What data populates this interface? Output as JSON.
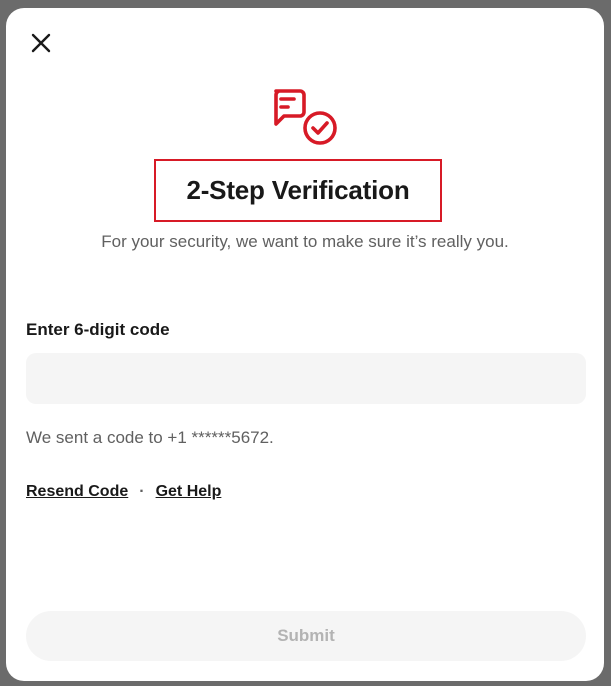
{
  "dialog": {
    "close_icon": "close-icon",
    "header_icon": "chat-check-icon",
    "title": "2-Step Verification",
    "subtitle": "For your security, we want to make sure it’s really you.",
    "code_field": {
      "label": "Enter 6-digit code",
      "value": "",
      "placeholder": ""
    },
    "sent_message": "We sent a code to +1 ******5672.",
    "links": {
      "resend": "Resend Code",
      "separator": "·",
      "help": "Get Help"
    },
    "submit_label": "Submit"
  },
  "colors": {
    "accent": "#d71a26",
    "text_primary": "#191919",
    "text_secondary": "#606060",
    "input_bg": "#f5f5f5",
    "disabled_text": "#b3b3b3"
  }
}
